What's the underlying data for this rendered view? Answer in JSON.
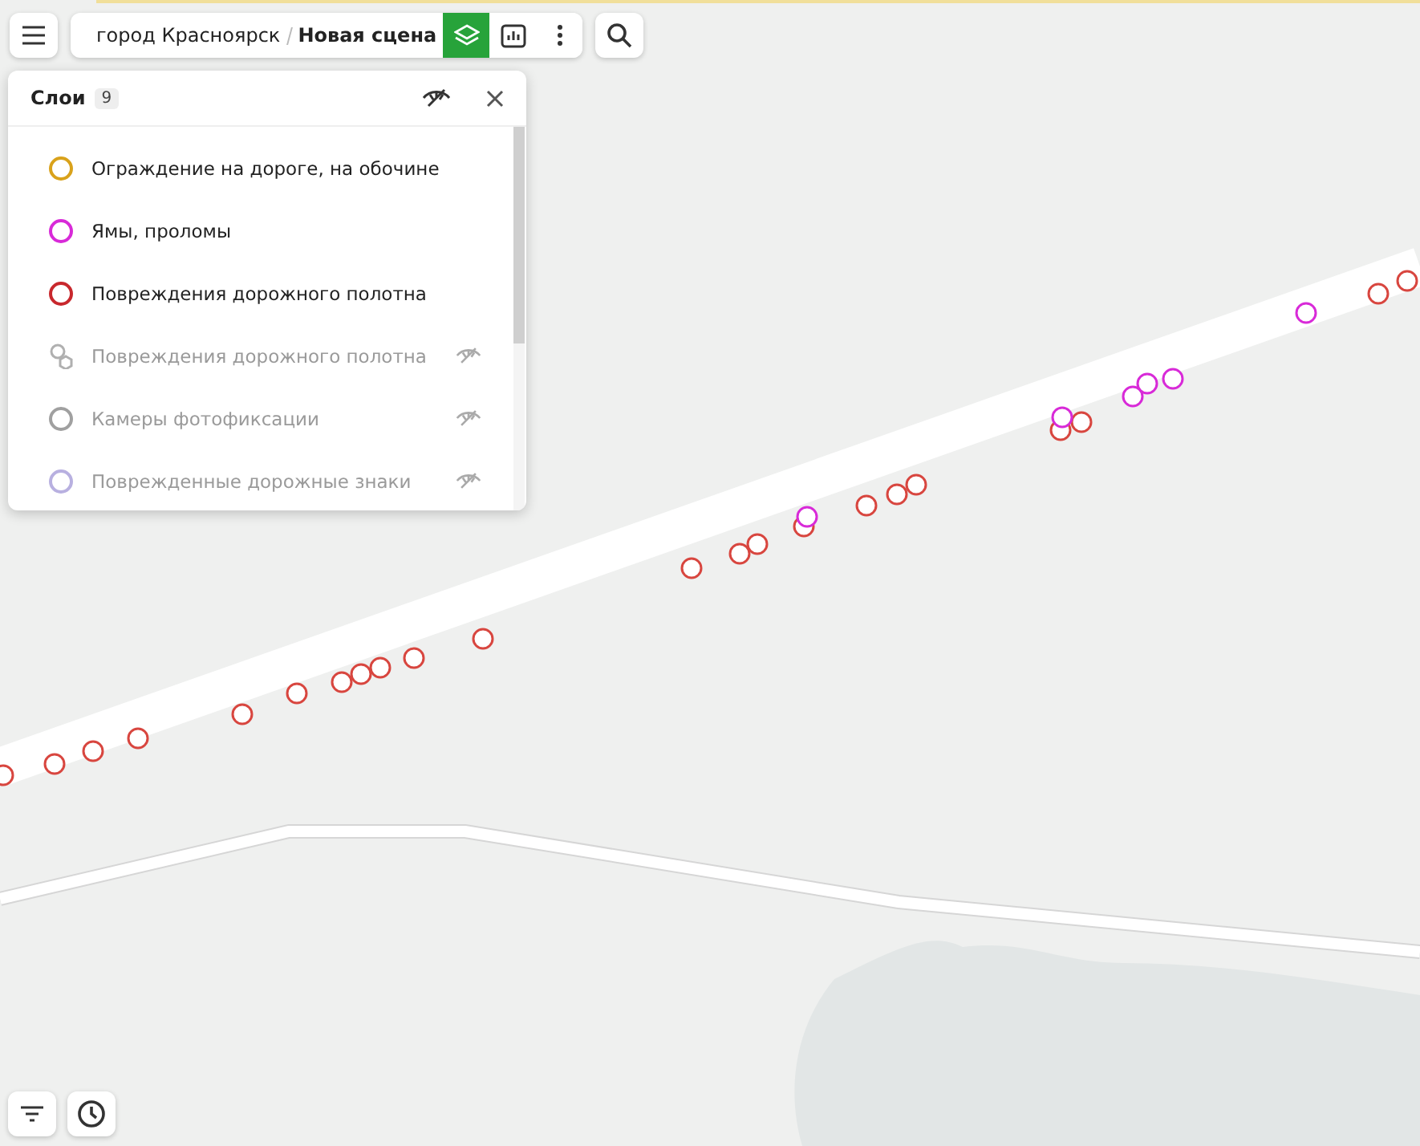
{
  "toolbar": {
    "breadcrumb": [
      {
        "label": "город Красноярск"
      },
      {
        "label": "Новая сцена"
      }
    ],
    "layers_active": true
  },
  "layers_panel": {
    "title": "Слои",
    "count": "9",
    "items": [
      {
        "label": "Ограждение на дороге, на обочине",
        "kind": "circle",
        "color": "#d9a21b",
        "hidden": false
      },
      {
        "label": "Ямы, проломы",
        "kind": "circle",
        "color": "#d82ad8",
        "hidden": false
      },
      {
        "label": "Повреждения дорожного полотна",
        "kind": "circle",
        "color": "#c8282d",
        "hidden": false
      },
      {
        "label": "Повреждения дорожного полотна",
        "kind": "cluster",
        "color": "#b0b0b0",
        "hidden": true
      },
      {
        "label": "Камеры фотофиксации",
        "kind": "circle",
        "color": "#a0a0a0",
        "hidden": true
      },
      {
        "label": "Поврежденные дорожные знаки",
        "kind": "circle",
        "color": "#b8b0e0",
        "hidden": true
      }
    ]
  }
}
